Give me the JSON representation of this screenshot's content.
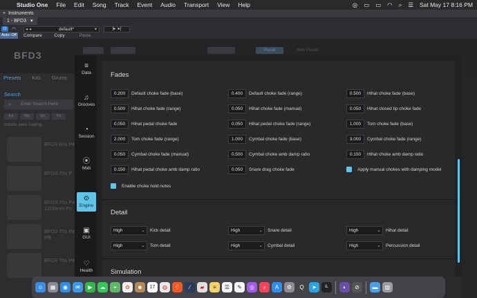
{
  "menubar": {
    "app": "Studio One",
    "items": [
      "File",
      "Edit",
      "Song",
      "Track",
      "Event",
      "Audio",
      "Transport",
      "View",
      "Help"
    ],
    "datetime": "Sat May 17  8:16 PM"
  },
  "instruments_bar": {
    "title": "Instruments"
  },
  "tab": {
    "label": "1 - BFD3",
    "caret": "▾"
  },
  "toolbar": {
    "preset": "default*",
    "compare": "Compare",
    "copy": "Copy",
    "paste": "Paste",
    "auto_off": "Auto: Off"
  },
  "background": {
    "logo": "BFD3",
    "left_tabs": [
      "Presets",
      "Kits",
      "Drums"
    ],
    "search_label": "Search",
    "search_placeholder": "Enter Search Here",
    "chips": [
      "Kit",
      "Mn",
      "Sn",
      "Pk"
    ],
    "status": "Installs were loading...",
    "kits": [
      "BFD3 60s Pearl",
      "BFD3 70s P...",
      "BFD3 70s Pearl 1200mm Pc",
      "BFD3 70s Pe... PB",
      "BFD3 70s Pe..."
    ],
    "top_labels": [
      "Preset",
      "New Preset"
    ]
  },
  "nav": [
    {
      "label": "Data",
      "icon": "≡"
    },
    {
      "label": "Grooves",
      "icon": "♫"
    },
    {
      "label": "Session",
      "icon": "◔"
    },
    {
      "label": "Midi",
      "icon": "⦿"
    },
    {
      "label": "Engine",
      "icon": "⚙"
    },
    {
      "label": "GUI",
      "icon": "▣"
    },
    {
      "label": "Health",
      "icon": "♡"
    }
  ],
  "fades": {
    "title": "Fades",
    "rows": [
      [
        {
          "value": "0.200",
          "label": "Default choke fade (base)"
        },
        {
          "value": "0.400",
          "label": "Default choke fade (range)"
        },
        {
          "value": "0.500",
          "label": "Hihat choke fade (base)"
        }
      ],
      [
        {
          "value": "0.500",
          "label": "Hihat choke fade (range)"
        },
        {
          "value": "0.050",
          "label": "Hihat choke fade (manual)"
        },
        {
          "value": "0.050",
          "label": "Hihat closed tip choke fade"
        }
      ],
      [
        {
          "value": "0.050",
          "label": "Hihat pedal choke fade"
        },
        {
          "value": "0.050",
          "label": "Hihat pedal choke fade (range)"
        },
        {
          "value": "1.000",
          "label": "Tom choke fade (base)"
        }
      ],
      [
        {
          "value": "2.000",
          "label": "Tom choke fade (range)"
        },
        {
          "value": "1.000",
          "label": "Cymbal choke fade (base)"
        },
        {
          "value": "3.000",
          "label": "Cymbal choke fade (range)"
        }
      ],
      [
        {
          "value": "0.050",
          "label": "Cymbal choke fade (manual)"
        },
        {
          "value": "0.500",
          "label": "Cymbal choke amb damp ratio"
        },
        {
          "value": "0.150",
          "label": "Hihat choke amb damp ratio"
        }
      ],
      [
        {
          "value": "0.150",
          "label": "Hihat pedal choke amb damp ratio"
        },
        {
          "value": "0.050",
          "label": "Snare drag choke fade"
        },
        {
          "checkbox": true,
          "label": "Apply manual chokes with damping model"
        }
      ]
    ],
    "hold_notes": "Enable choke hold notes"
  },
  "detail": {
    "title": "Detail",
    "rows": [
      [
        {
          "value": "High",
          "label": "Kick detail"
        },
        {
          "value": "High",
          "label": "Snare detail"
        },
        {
          "value": "High",
          "label": "Hihat detail"
        }
      ],
      [
        {
          "value": "High",
          "label": "Tom detail"
        },
        {
          "value": "High",
          "label": "Cymbal detail"
        },
        {
          "value": "High",
          "label": "Percussion detail"
        }
      ]
    ]
  },
  "simulation": {
    "title": "Simulation"
  },
  "colors": {
    "accent": "#5fc5e8",
    "panel": "#29292c",
    "nav": "#1a1a1c"
  },
  "dock": {
    "icons": [
      "finder-icon",
      "launchpad-icon",
      "safari-icon",
      "mail-icon",
      "facetime-icon",
      "messages-icon",
      "maps-icon",
      "photos-icon",
      "contacts-icon",
      "calendar-icon",
      "chrome-icon",
      "brave-icon",
      "studio-one-icon",
      "studio-one-pro-icon",
      "notes-icon",
      "reminders-icon",
      "freeform-icon",
      "podcasts-icon",
      "music-icon",
      "app-store-icon",
      "system-settings-icon",
      "quicktime-icon",
      "telegram-icon",
      "ilok-icon",
      "affinity-icon",
      "other-app-icon",
      "folder-icon",
      "trash-icon"
    ],
    "calendar_day": "17"
  }
}
